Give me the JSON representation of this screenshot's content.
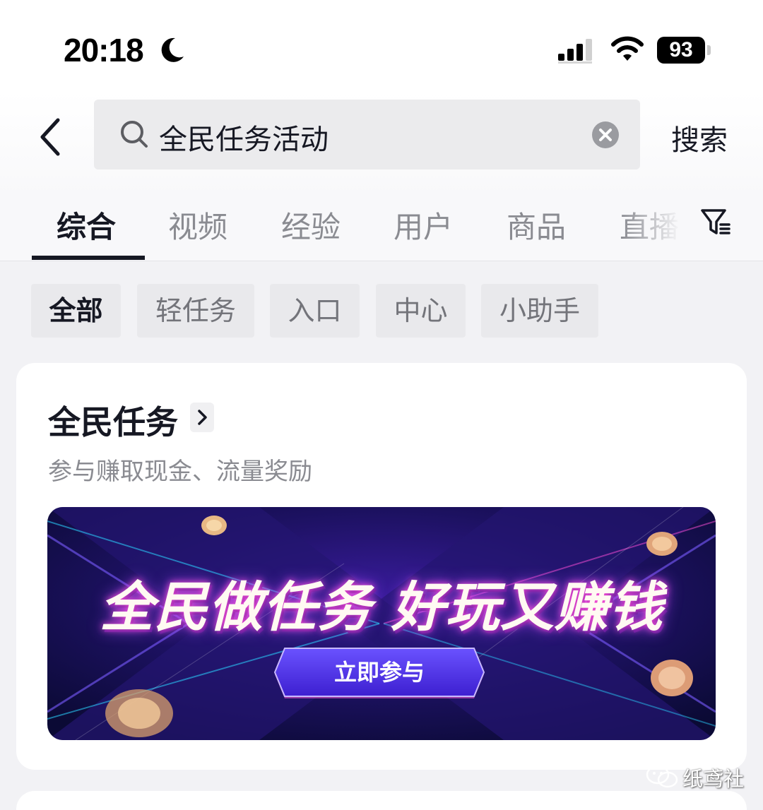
{
  "status_bar": {
    "time": "20:18",
    "battery": "93",
    "icons": [
      "moon-icon",
      "signal-icon",
      "wifi-icon",
      "battery-icon"
    ]
  },
  "search": {
    "back_icon": "chevron-left-icon",
    "query": "全民任务活动",
    "search_icon": "search-icon",
    "clear_icon": "clear-icon",
    "button_label": "搜索"
  },
  "tabs": [
    {
      "label": "综合",
      "active": true
    },
    {
      "label": "视频",
      "active": false
    },
    {
      "label": "经验",
      "active": false
    },
    {
      "label": "用户",
      "active": false
    },
    {
      "label": "商品",
      "active": false
    },
    {
      "label": "直播",
      "active": false
    }
  ],
  "filter_icon": "filter-icon",
  "chips": [
    {
      "label": "全部",
      "active": true
    },
    {
      "label": "轻任务",
      "active": false
    },
    {
      "label": "入口",
      "active": false
    },
    {
      "label": "中心",
      "active": false
    },
    {
      "label": "小助手",
      "active": false
    }
  ],
  "card": {
    "title": "全民任务",
    "subtitle": "参与赚取现金、流量奖励",
    "banner": {
      "headline": "全民做任务 好玩又赚钱",
      "button_label": "立即参与"
    }
  },
  "watermark": {
    "text": "纸鸢社",
    "icon": "wechat-icon"
  },
  "colors": {
    "text_primary": "#161823",
    "text_secondary": "#8a8b91",
    "page_bg": "#f2f2f5",
    "banner_bg": "#1a1150",
    "banner_accent": "#6b3cff"
  }
}
